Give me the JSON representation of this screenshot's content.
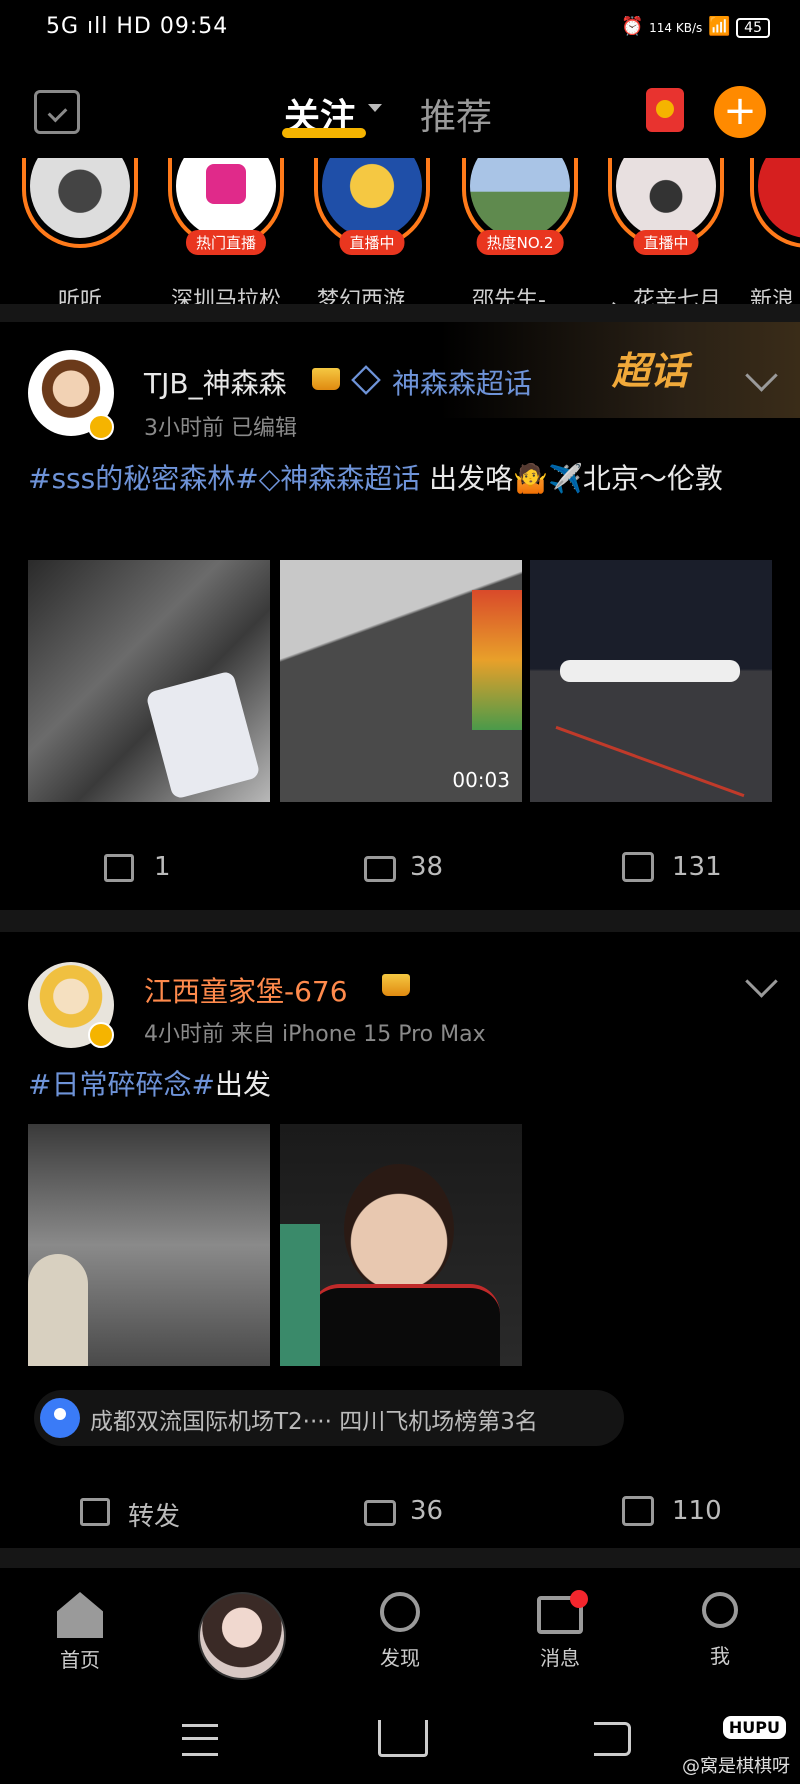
{
  "status_bar": {
    "left": "5G ıll HD 09:54",
    "speed": "114 KB/s",
    "battery": "45"
  },
  "top_nav": {
    "tab_follow": "关注",
    "tab_recommend": "推荐",
    "plus": "+"
  },
  "stories": [
    {
      "label": "听听",
      "badge": ""
    },
    {
      "label": "深圳马拉松",
      "badge": "热门直播"
    },
    {
      "label": "梦幻西游…",
      "badge": "直播中"
    },
    {
      "label": "邵先生-…",
      "badge": "热度NO.2"
    },
    {
      "label": "、花辛七月",
      "badge": "直播中"
    },
    {
      "label": "新浪",
      "badge": ""
    }
  ],
  "post1": {
    "username": "TJB_神森森",
    "chaohua": "神森森超话",
    "meta": "3小时前  已编辑",
    "badge": "超话",
    "tag1": "#sss的秘密森林#",
    "tag2": "神森森超话",
    "text": " 出发咯🤷✈️北京～伦敦",
    "video_duration": "00:03",
    "shares": "1",
    "comments": "38",
    "likes": "131"
  },
  "post2": {
    "username": "江西童家堡-676",
    "meta": "4小时前  来自 iPhone 15 Pro Max",
    "tag": "#日常碎碎念#",
    "text": "出发",
    "location": "成都双流国际机场T2···· 四川飞机场榜第3名",
    "share_label": "转发",
    "comments": "36",
    "likes": "110"
  },
  "tabbar": {
    "home": "首页",
    "discover": "发现",
    "messages": "消息",
    "me": "我"
  },
  "watermark": "@窝是棋棋呀",
  "hupu": "HUPU"
}
